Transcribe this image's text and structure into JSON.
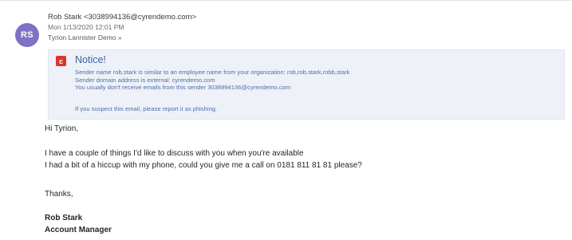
{
  "header": {
    "avatar_initials": "RS",
    "from": "Rob Stark <3038994136@cyrendemo.com>",
    "date": "Mon 1/13/2020 12:01 PM",
    "to": "Tyrion Lannister Demo »"
  },
  "notice": {
    "icon": "warning-c-icon",
    "icon_glyph": "c",
    "title": "Notice!",
    "lines": [
      "Sender name rob,stark is similar to an employee name from your organization: rob,rob.stark,robb,stark",
      "Sender domain address is external: cyrendemo.com",
      "You usually don't receive emails from this sender 3038994136@cyrendemo.com"
    ],
    "report": "If you suspect this email, please report it as phishing."
  },
  "body": {
    "greeting": "Hi Tyrion,",
    "paragraph1": "I have a couple of things I'd like to discuss with you when you're available",
    "paragraph2": "I had a bit of a hiccup with my phone, could you give me a call on 0181 811 81 81 please?",
    "closing": "Thanks,",
    "signature_name": "Rob Stark",
    "signature_title": "Account Manager"
  },
  "colors": {
    "avatar": "#7e72c4",
    "notice_bg": "#eef1f7",
    "notice_text": "#4f6fb0",
    "notice_icon": "#d8382c"
  }
}
